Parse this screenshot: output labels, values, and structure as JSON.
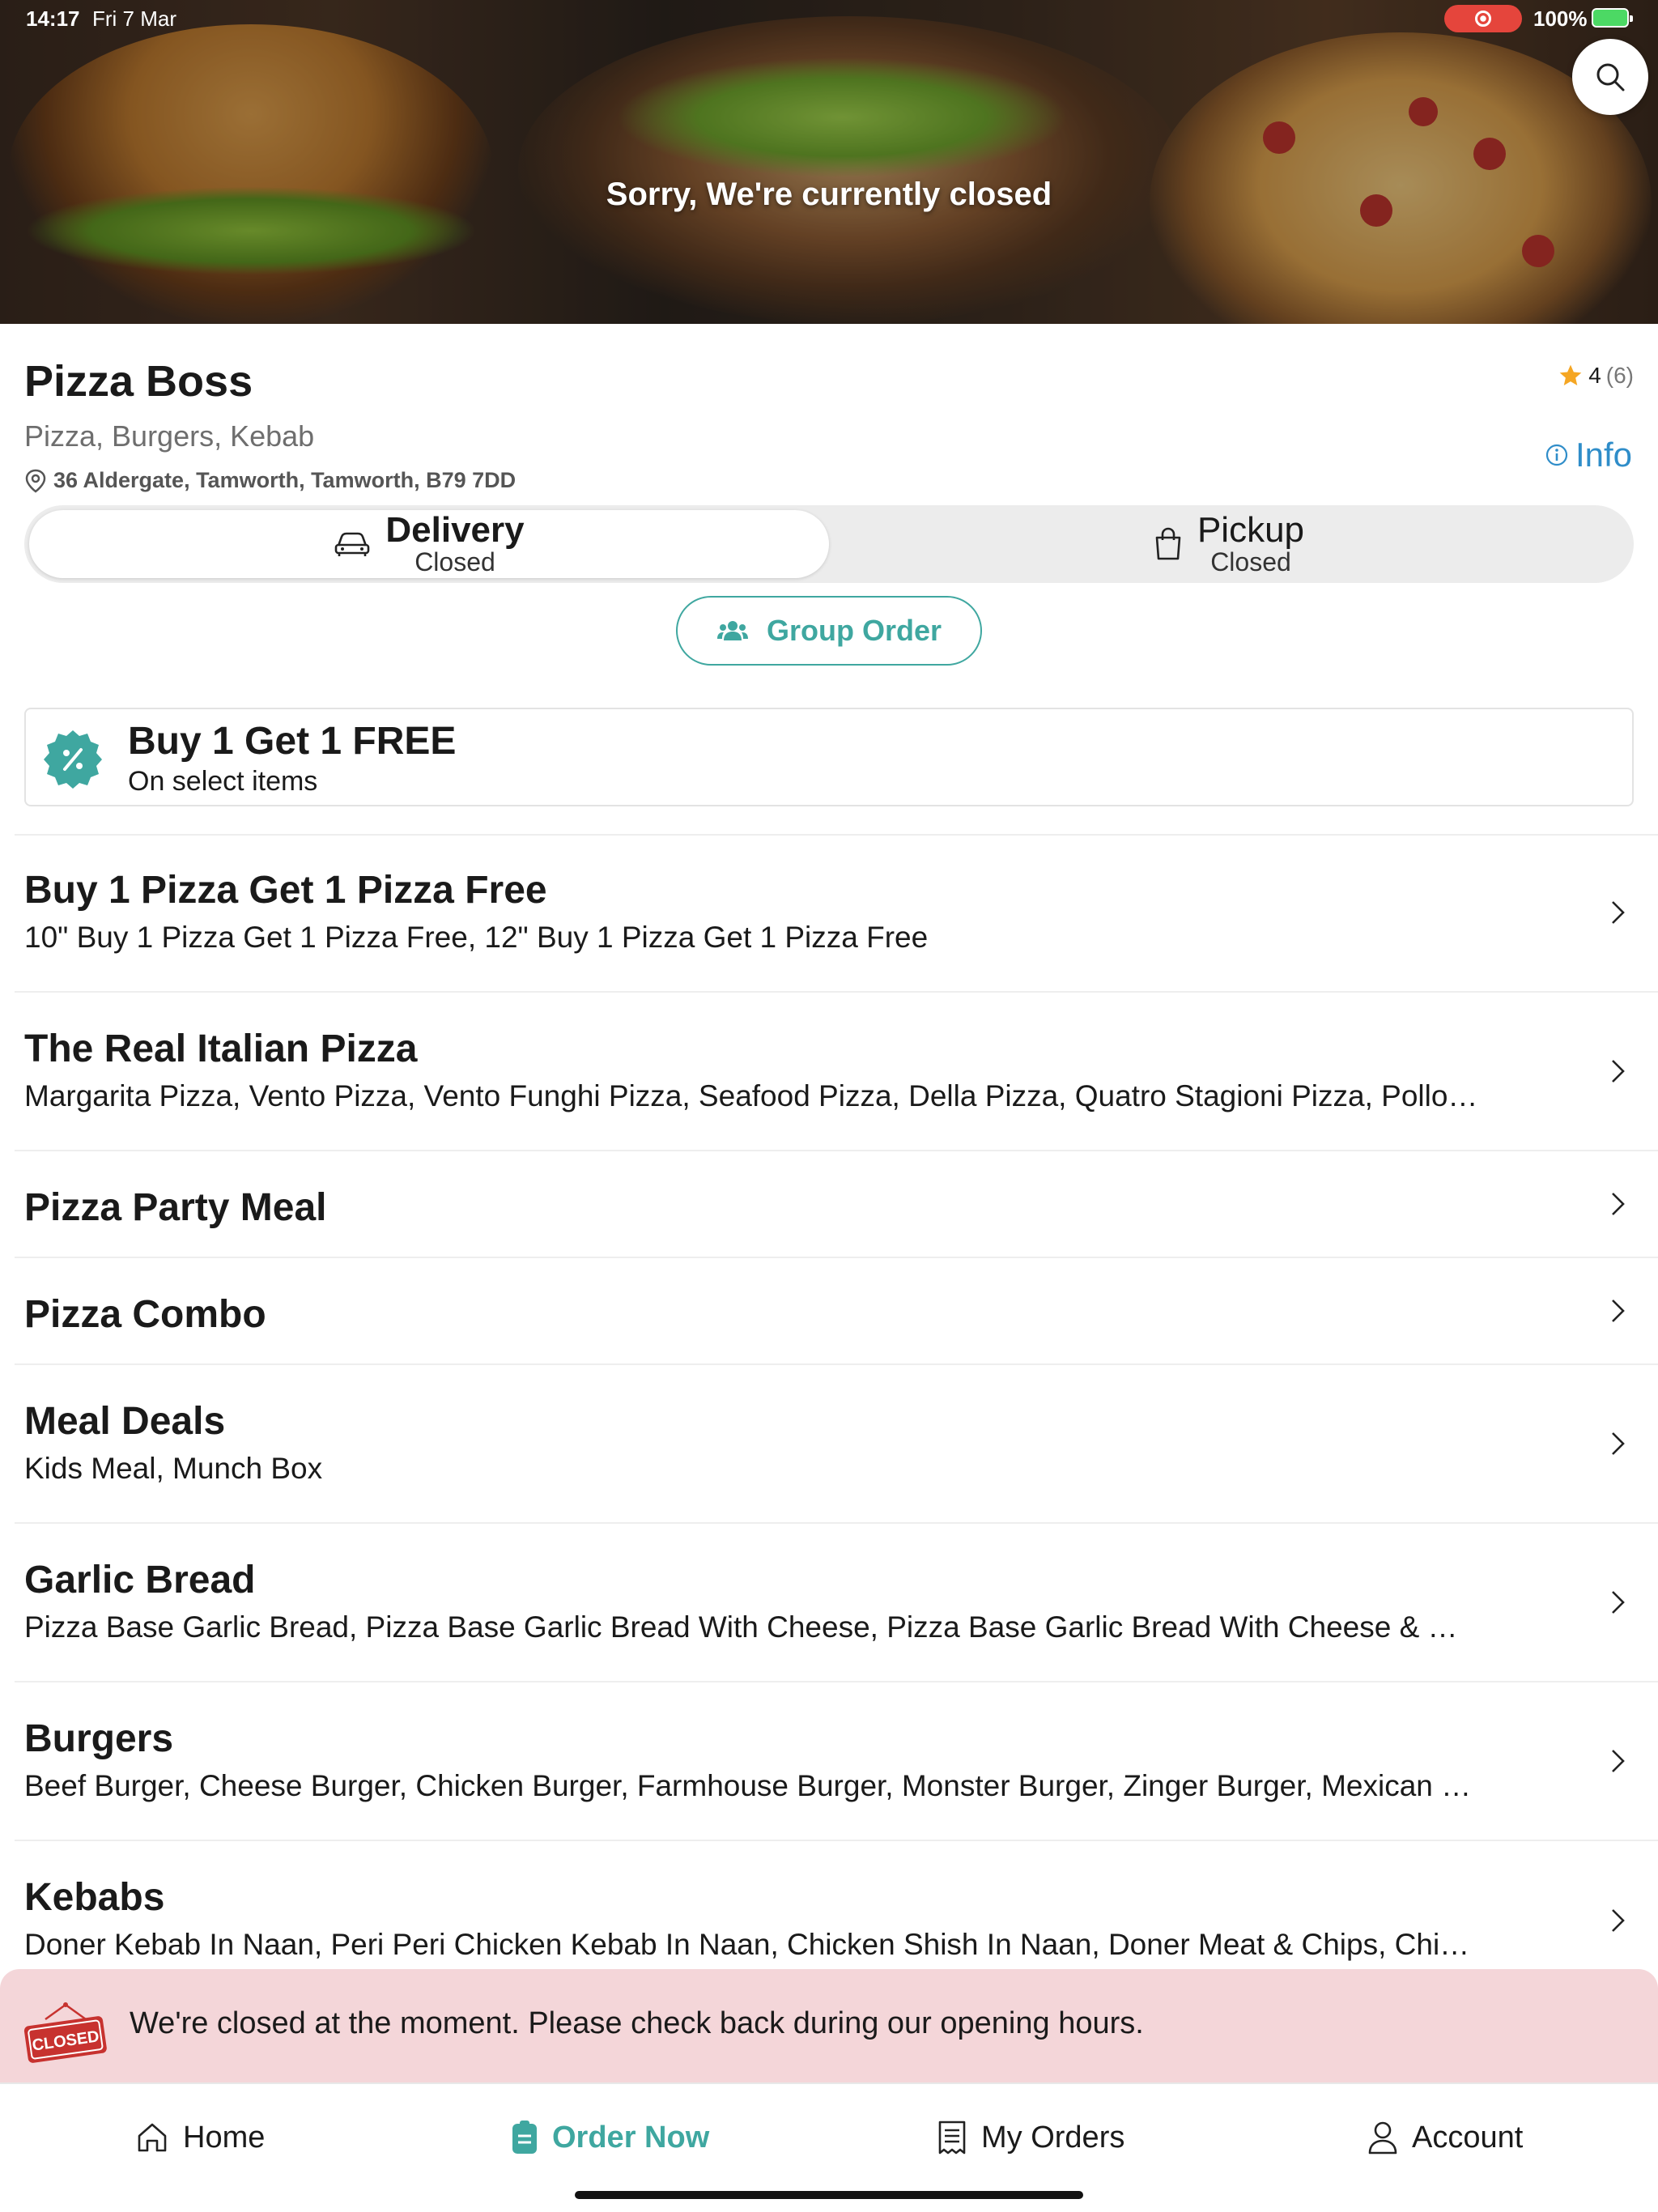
{
  "status_bar": {
    "time": "14:17",
    "date": "Fri 7 Mar",
    "battery": "100%"
  },
  "hero": {
    "banner": "Sorry, We're currently closed"
  },
  "restaurant": {
    "name": "Pizza Boss",
    "cuisines": "Pizza, Burgers, Kebab",
    "address": "36 Aldergate, Tamworth, Tamworth, B79 7DD",
    "rating": "4",
    "rating_count": "(6)",
    "info_label": "Info"
  },
  "order_mode": {
    "delivery": {
      "label": "Delivery",
      "status": "Closed"
    },
    "pickup": {
      "label": "Pickup",
      "status": "Closed"
    },
    "selected": "delivery"
  },
  "group_order_label": "Group Order",
  "promo": {
    "title": "Buy 1 Get 1 FREE",
    "subtitle": "On select items"
  },
  "categories": [
    {
      "name": "Buy 1 Pizza Get 1 Pizza Free",
      "items": "10\" Buy 1 Pizza Get 1 Pizza Free, 12\" Buy 1 Pizza Get 1 Pizza Free"
    },
    {
      "name": "The Real Italian Pizza",
      "items": "Margarita Pizza, Vento Pizza, Vento Funghi Pizza, Seafood Pizza, Della Pizza, Quatro Stagioni Pizza, Pollo Pi..."
    },
    {
      "name": "Pizza Party Meal",
      "items": ""
    },
    {
      "name": "Pizza Combo",
      "items": ""
    },
    {
      "name": "Meal Deals",
      "items": "Kids Meal, Munch Box"
    },
    {
      "name": "Garlic Bread",
      "items": "Pizza Base Garlic Bread, Pizza Base Garlic Bread With Cheese, Pizza Base Garlic Bread With Cheese & Mus..."
    },
    {
      "name": "Burgers",
      "items": "Beef Burger, Cheese Burger, Chicken Burger, Farmhouse Burger, Monster Burger, Zinger Burger, Mexican B..."
    },
    {
      "name": "Kebabs",
      "items": "Doner Kebab In Naan, Peri Peri Chicken Kebab In Naan, Chicken Shish In Naan, Doner Meat & Chips, Chick..."
    }
  ],
  "closed_notice": {
    "sign_text": "CLOSED",
    "message": "We're closed at the moment. Please check back during our opening hours."
  },
  "tabs": [
    {
      "label": "Home",
      "icon": "home-icon"
    },
    {
      "label": "Order Now",
      "icon": "order-icon",
      "active": true
    },
    {
      "label": "My Orders",
      "icon": "receipt-icon"
    },
    {
      "label": "Account",
      "icon": "person-icon"
    }
  ],
  "colors": {
    "accent": "#3fa7a0",
    "info": "#2f8dc9",
    "closed_bg": "#f4d6d9",
    "star": "#f5a623",
    "recording": "#e5453c"
  }
}
